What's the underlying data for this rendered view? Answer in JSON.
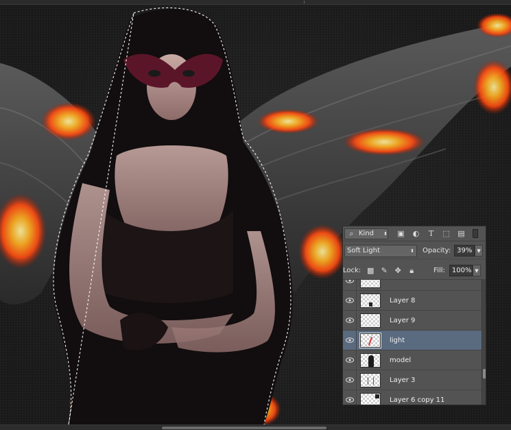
{
  "colors": {
    "panel_bg": "#535353",
    "selected_layer_bg": "#5a6a7f",
    "canvas_bg": "#1a1a1a",
    "fire": "#ff5a12"
  },
  "layers_panel": {
    "filter": {
      "kind_label": "Kind",
      "icons": [
        "pixel-filter-icon",
        "adjustment-filter-icon",
        "type-filter-icon",
        "shape-filter-icon",
        "smart-object-filter-icon"
      ]
    },
    "blend_mode": "Soft Light",
    "opacity_label": "Opacity:",
    "opacity_value": "39%",
    "lock_label": "Lock:",
    "lock_icons": [
      "lock-transparent-icon",
      "lock-image-icon",
      "lock-position-icon",
      "lock-all-icon"
    ],
    "fill_label": "Fill:",
    "fill_value": "100%",
    "layers": [
      {
        "name": "",
        "visible": true,
        "selected": false,
        "thumb": "partial"
      },
      {
        "name": "Layer 8",
        "visible": true,
        "selected": false,
        "thumb": "dark-spot"
      },
      {
        "name": "Layer 9",
        "visible": true,
        "selected": false,
        "thumb": "empty"
      },
      {
        "name": "light",
        "visible": true,
        "selected": true,
        "thumb": "red-stroke"
      },
      {
        "name": "model",
        "visible": true,
        "selected": false,
        "thumb": "figure"
      },
      {
        "name": "Layer 3",
        "visible": true,
        "selected": false,
        "thumb": "lines"
      },
      {
        "name": "Layer 6 copy 11",
        "visible": true,
        "selected": false,
        "thumb": "smart"
      }
    ]
  }
}
